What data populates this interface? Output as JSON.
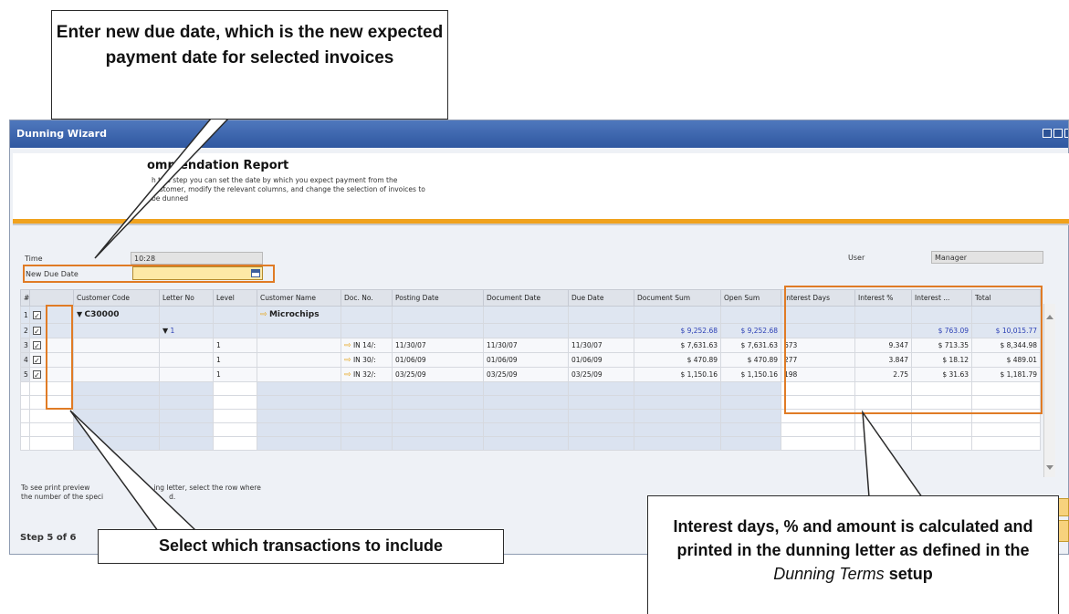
{
  "window": {
    "title": "Dunning Wizard",
    "recommendation_title": "ommendation Report",
    "description_lines": [
      "h this step you can set the date by which you expect payment from the",
      "customer, modify the relevant columns, and change the selection of invoices to",
      "be dunned"
    ]
  },
  "form": {
    "time_label": "Time",
    "time_value": "10:28",
    "new_due_date_label": "New Due Date",
    "new_due_date_value": "",
    "user_label": "User",
    "user_value": "Manager"
  },
  "table": {
    "columns": [
      "#",
      "Customer Code",
      "Letter No",
      "Level",
      "Customer Name",
      "Doc. No.",
      "Posting Date",
      "Document Date",
      "Due Date",
      "Document Sum",
      "Open Sum",
      "Interest Days",
      "Interest %",
      "Interest ...",
      "Total"
    ],
    "rows": [
      {
        "num": "1",
        "checked": true,
        "customer_code": "C30000",
        "letter_no": "",
        "level": "",
        "customer_name": "Microchips",
        "doc_no": "",
        "posting_date": "",
        "document_date": "",
        "due_date": "",
        "document_sum": "",
        "open_sum": "",
        "interest_days": "",
        "interest_pct": "",
        "interest_amt": "",
        "total": ""
      },
      {
        "num": "2",
        "checked": true,
        "customer_code": "",
        "letter_no": "1",
        "level": "",
        "customer_name": "",
        "doc_no": "",
        "posting_date": "",
        "document_date": "",
        "due_date": "",
        "document_sum": "$ 9,252.68",
        "open_sum": "$ 9,252.68",
        "interest_days": "",
        "interest_pct": "",
        "interest_amt": "$ 763.09",
        "total": "$ 10,015.77"
      },
      {
        "num": "3",
        "checked": true,
        "customer_code": "",
        "letter_no": "",
        "level": "1",
        "customer_name": "",
        "doc_no": "IN 14/:",
        "posting_date": "11/30/07",
        "document_date": "11/30/07",
        "due_date": "11/30/07",
        "document_sum": "$ 7,631.63",
        "open_sum": "$ 7,631.63",
        "interest_days": "673",
        "interest_pct": "9.347",
        "interest_amt": "$ 713.35",
        "total": "$ 8,344.98"
      },
      {
        "num": "4",
        "checked": true,
        "customer_code": "",
        "letter_no": "",
        "level": "1",
        "customer_name": "",
        "doc_no": "IN 30/:",
        "posting_date": "01/06/09",
        "document_date": "01/06/09",
        "due_date": "01/06/09",
        "document_sum": "$ 470.89",
        "open_sum": "$ 470.89",
        "interest_days": "277",
        "interest_pct": "3.847",
        "interest_amt": "$ 18.12",
        "total": "$ 489.01"
      },
      {
        "num": "5",
        "checked": true,
        "customer_code": "",
        "letter_no": "",
        "level": "1",
        "customer_name": "",
        "doc_no": "IN 32/:",
        "posting_date": "03/25/09",
        "document_date": "03/25/09",
        "due_date": "03/25/09",
        "document_sum": "$ 1,150.16",
        "open_sum": "$ 1,150.16",
        "interest_days": "198",
        "interest_pct": "2.75",
        "interest_amt": "$ 31.63",
        "total": "$ 1,181.79"
      }
    ]
  },
  "footer": {
    "hint_line1": "To see print preview",
    "hint_line1_cont": "ing letter, select the row where",
    "hint_line2": "the number of the speci",
    "hint_line2_cont": "d.",
    "step": "Step 5 of 6"
  },
  "callouts": {
    "due_date": "Enter new due date, which is the new expected payment date for selected invoices",
    "select": "Select which transactions to include",
    "interest_part1": "Interest days, % and amount is calculated and printed in the dunning letter as defined in the",
    "interest_italic": "Dunning Terms",
    "interest_part2": "setup"
  },
  "colors": {
    "highlight": "#e07b25",
    "titlebar": "#2f57a0",
    "accent_bar": "#f0a21d"
  }
}
